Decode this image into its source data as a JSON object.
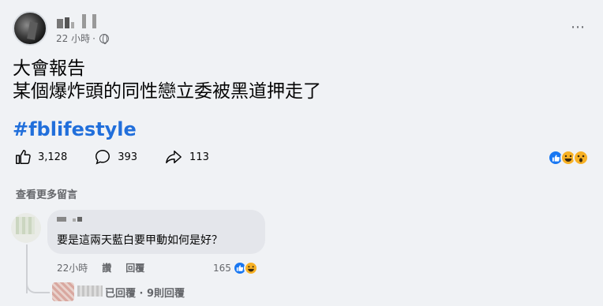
{
  "post": {
    "time": "22 小時",
    "separator": "·",
    "more_icon": "⋯",
    "line1": "大會報告",
    "line2": "某個爆炸頭的同性戀立委被黑道押走了",
    "hashtag": "#fblifestyle"
  },
  "stats": {
    "likes": "3,128",
    "comments": "393",
    "shares": "113",
    "reaction_icons": [
      "like-icon",
      "haha-icon",
      "wow-icon"
    ]
  },
  "comments_section": {
    "see_more": "查看更多留言",
    "comment": {
      "text": "要是這兩天藍白要甲動如何是好？",
      "time": "22小時",
      "like_label": "讚",
      "reply_label": "回覆",
      "reaction_count": "165"
    },
    "replies_summary": "已回覆 · 9則回覆"
  },
  "colors": {
    "background": "#f0f2f5",
    "hashtag": "#216fdb",
    "meta_text": "#65676b",
    "bubble": "#e4e6eb",
    "like_blue": "#1877f2",
    "emoji_yellow": "#f7b125"
  }
}
